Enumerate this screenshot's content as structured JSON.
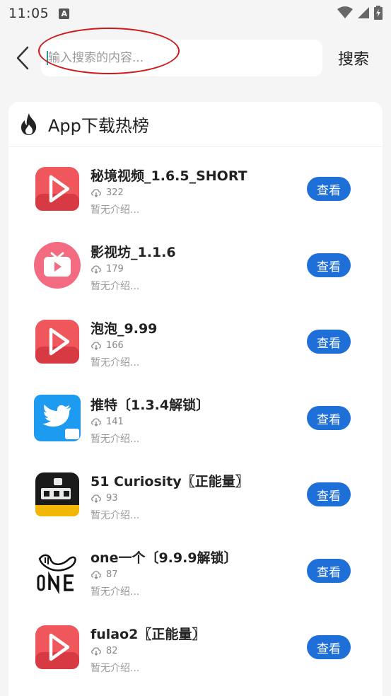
{
  "status": {
    "time": "11:05",
    "notification_icon": "A"
  },
  "search": {
    "placeholder": "输入搜索的内容...",
    "value": "",
    "button_label": "搜索"
  },
  "section": {
    "title": "App下载热榜"
  },
  "apps": [
    {
      "name": "秘境视频_1.6.5_SHORT",
      "downloads": "322",
      "desc": "暂无介绍...",
      "button": "查看",
      "icon": "play-icon-red"
    },
    {
      "name": "影视坊_1.1.6",
      "downloads": "179",
      "desc": "暂无介绍...",
      "button": "查看",
      "icon": "tv-icon-pink"
    },
    {
      "name": "泡泡_9.99",
      "downloads": "166",
      "desc": "暂无介绍...",
      "button": "查看",
      "icon": "play-icon-red"
    },
    {
      "name": "推特〔1.3.4解锁〕",
      "downloads": "141",
      "desc": "暂无介绍...",
      "button": "查看",
      "icon": "twitter-bird-icon"
    },
    {
      "name": "51 Curiosity〖正能量〗",
      "downloads": "93",
      "desc": "暂无介绍...",
      "button": "查看",
      "icon": "curiosity-51-icon"
    },
    {
      "name": "one一个〔9.9.9解锁〕",
      "downloads": "87",
      "desc": "暂无介绍...",
      "button": "查看",
      "icon": "one-logo-icon"
    },
    {
      "name": "fulao2〖正能量〗",
      "downloads": "82",
      "desc": "暂无介绍...",
      "button": "查看",
      "icon": "play-icon-red"
    }
  ],
  "colors": {
    "accent": "#1f6fd9",
    "annotation": "#d0191b",
    "background": "#f5f5f5"
  }
}
